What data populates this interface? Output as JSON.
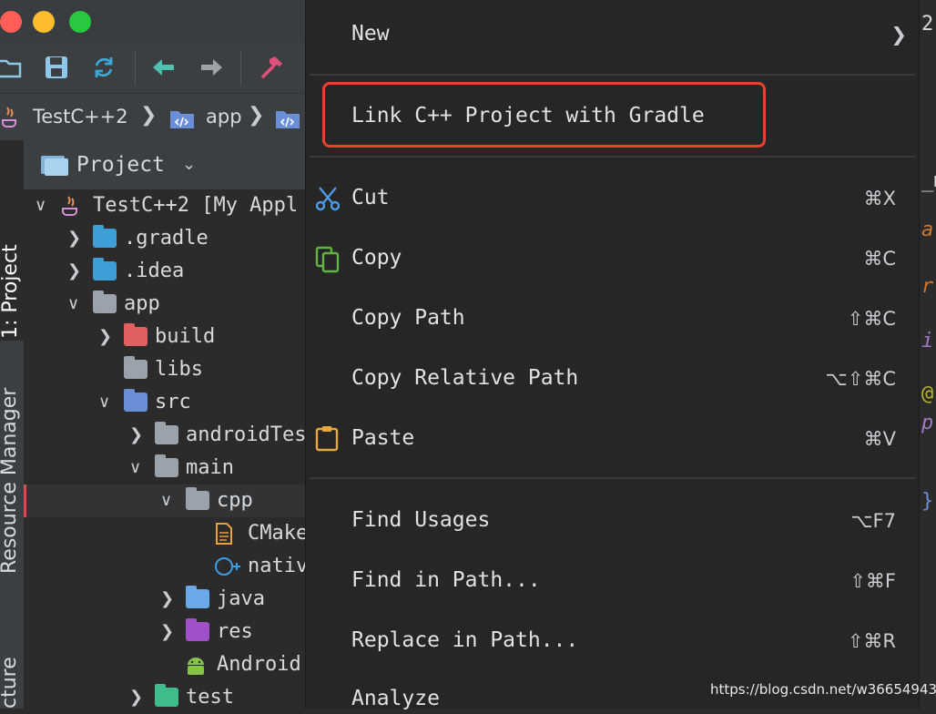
{
  "breadcrumb": {
    "items": [
      "TestC++2",
      "app"
    ]
  },
  "side_tabs": {
    "project": "1: Project",
    "resource_manager": "Resource Manager",
    "structure": "cture"
  },
  "project_panel": {
    "title": "Project"
  },
  "tree": [
    {
      "label": "TestC++2 [My Appl",
      "icon": "java-icon"
    },
    {
      "label": ".gradle",
      "icon": "gradle-folder-icon"
    },
    {
      "label": ".idea",
      "icon": "idea-folder-icon"
    },
    {
      "label": "app",
      "icon": "module-folder-icon"
    },
    {
      "label": "build",
      "icon": "build-folder-icon"
    },
    {
      "label": "libs",
      "icon": "folder-icon"
    },
    {
      "label": "src",
      "icon": "source-folder-icon"
    },
    {
      "label": "androidTes",
      "icon": "folder-icon"
    },
    {
      "label": "main",
      "icon": "folder-icon"
    },
    {
      "label": "cpp",
      "icon": "folder-icon"
    },
    {
      "label": "CMake",
      "icon": "cmake-file-icon"
    },
    {
      "label": "nativ",
      "icon": "cpp-file-icon"
    },
    {
      "label": "java",
      "icon": "java-folder-icon"
    },
    {
      "label": "res",
      "icon": "res-folder-icon"
    },
    {
      "label": "Android",
      "icon": "android-icon"
    },
    {
      "label": "test",
      "icon": "test-folder-icon"
    }
  ],
  "context_menu": {
    "new": {
      "label": "New"
    },
    "link_cpp": {
      "label": "Link C++ Project with Gradle"
    },
    "cut": {
      "label": "Cut",
      "shortcut": "⌘X"
    },
    "copy": {
      "label": "Copy",
      "shortcut": "⌘C"
    },
    "copy_path": {
      "label": "Copy Path",
      "shortcut": "⇧⌘C"
    },
    "copy_relative_path": {
      "label": "Copy Relative Path",
      "shortcut": "⌥⇧⌘C"
    },
    "paste": {
      "label": "Paste",
      "shortcut": "⌘V"
    },
    "find_usages": {
      "label": "Find Usages",
      "shortcut": "⌥F7"
    },
    "find_in_path": {
      "label": "Find in Path...",
      "shortcut": "⇧⌘F"
    },
    "replace_in_path": {
      "label": "Replace in Path...",
      "shortcut": "⇧⌘R"
    },
    "analyze": {
      "label": "Analyze"
    }
  },
  "editor_fragments": {
    "tab_digit": "2",
    "frag1": "_m",
    "frag2": "a",
    "frag3": "r",
    "frag4": "i",
    "frag5": "@",
    "frag6": "p",
    "frag7": "}"
  },
  "watermark": "https://blog.csdn.net/w366549434",
  "colors": {
    "highlight_border": "#e8412c",
    "menu_bg": "#262626"
  }
}
